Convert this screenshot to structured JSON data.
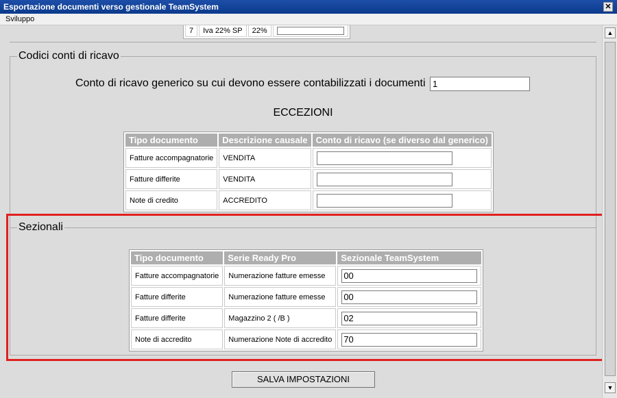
{
  "window": {
    "title": "Esportazione documenti verso gestionale TeamSystem",
    "close_glyph": "✕"
  },
  "menu": {
    "item": "Sviluppo"
  },
  "top_table": {
    "c1": "7",
    "c2": "Iva 22% SP",
    "c3": "22%"
  },
  "ricavo": {
    "legend": "Codici conti di ricavo",
    "generic_label": "Conto di ricavo generico su cui devono essere contabilizzati i documenti",
    "generic_value": "1",
    "eccezioni_title": "ECCEZIONI",
    "headers": [
      "Tipo documento",
      "Descrizione causale",
      "Conto di ricavo (se diverso dal generico)"
    ],
    "rows": [
      {
        "tipo": "Fatture accompagnatorie",
        "causale": "VENDITA",
        "conto": ""
      },
      {
        "tipo": "Fatture differite",
        "causale": "VENDITA",
        "conto": ""
      },
      {
        "tipo": "Note di credito",
        "causale": "ACCREDITO",
        "conto": ""
      }
    ]
  },
  "sezionali": {
    "legend": "Sezionali",
    "headers": [
      "Tipo documento",
      "Serie Ready Pro",
      "Sezionale TeamSystem"
    ],
    "rows": [
      {
        "tipo": "Fatture accompagnatorie",
        "serie": "Numerazione fatture emesse",
        "sezionale": "00"
      },
      {
        "tipo": "Fatture differite",
        "serie": "Numerazione fatture emesse",
        "sezionale": "00"
      },
      {
        "tipo": "Fatture differite",
        "serie": "Magazzino 2 ( /B )",
        "sezionale": "02"
      },
      {
        "tipo": "Note di accredito",
        "serie": "Numerazione Note di accredito",
        "sezionale": "70"
      }
    ]
  },
  "save_label": "SALVA IMPOSTAZIONI",
  "scroll": {
    "up": "▲",
    "down": "▼"
  },
  "colors": {
    "highlight": "#e02020",
    "titlebar": "#0b3a8c",
    "header": "#aeaeae"
  }
}
